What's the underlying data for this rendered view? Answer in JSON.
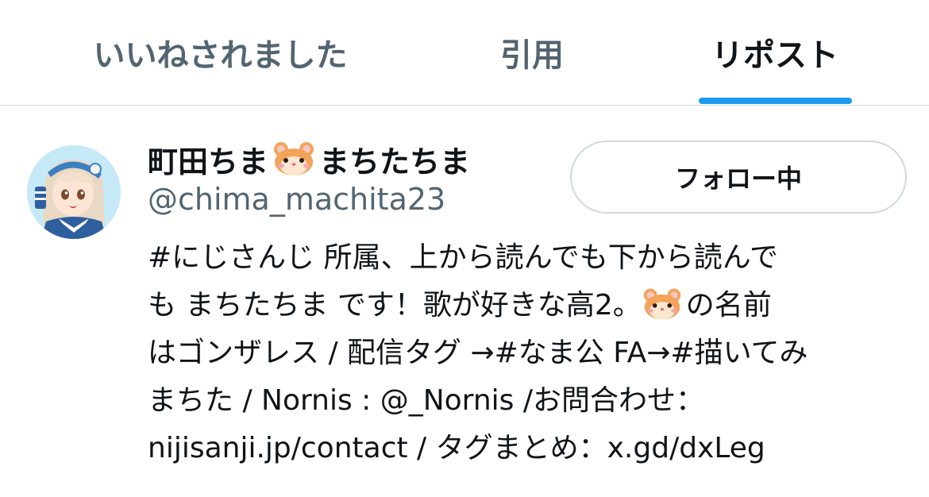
{
  "tabs": [
    {
      "label": "いいねされました",
      "active": false
    },
    {
      "label": "引用",
      "active": false
    },
    {
      "label": "リポスト",
      "active": true
    }
  ],
  "colors": {
    "accent": "#1d9bf0",
    "text_primary": "#0f1419",
    "text_secondary": "#536471",
    "border": "#cfd9de"
  },
  "user": {
    "name_before_emoji": "町田ちま",
    "name_emoji_icon": "hamster-face-icon",
    "name_after_emoji": "まちたちま",
    "handle": "@chima_machita23",
    "follow_button_label": "フォロー中",
    "avatar_icon": "user-avatar-anime-girl",
    "bio": {
      "line1": "#にじさんじ 所属、上から読んでも下から読んで",
      "line2_before_emoji": "も まちたちま です！歌が好きな高2。",
      "line2_emoji_icon": "hamster-face-icon",
      "line2_after_emoji": "の名前",
      "line3": "はゴンザレス / 配信タグ →#なま公 FA→#描いてみ",
      "line4": "まちた / Nornis : @_Nornis /お問合わせ：",
      "line5": "nijisanji.jp/contact / タグまとめ：x.gd/dxLeg"
    }
  }
}
